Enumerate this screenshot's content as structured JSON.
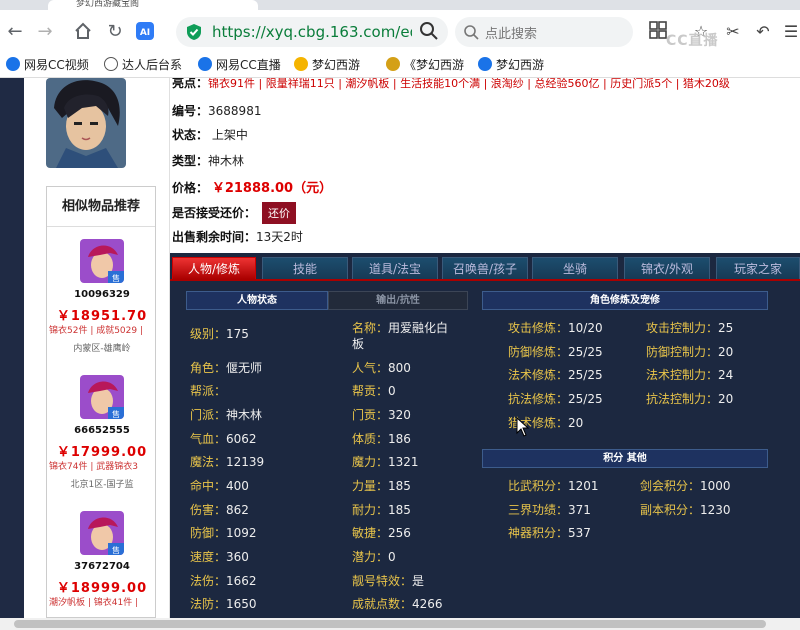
{
  "browser": {
    "tab_title": "梦幻西游藏宝阁",
    "url": "https://xyq.cbg.163.com/equip",
    "search_placeholder": "点此搜索",
    "watermark": "CC直播",
    "bookmarks": [
      {
        "label": "网易CC视频",
        "color": "#1a73e8"
      },
      {
        "label": "达人后台系",
        "color": "#555555"
      },
      {
        "label": "网易CC直播",
        "color": "#1a73e8"
      },
      {
        "label": "梦幻西游",
        "color": "#f5b400"
      },
      {
        "label": "《梦幻西游",
        "color": "#d4a017"
      },
      {
        "label": "梦幻西游",
        "color": "#1a73e8"
      }
    ]
  },
  "info": {
    "highlights_key": "亮点：",
    "highlights": "锦衣91件 | 限量祥瑞11只 | 潮汐帆板 | 生活技能10个满 | 浪淘纱 | 总经验560亿 | 历史门派5个 | 猎木20级",
    "id_key": "编号：",
    "id_value": "3688981",
    "status_key": "状态：",
    "status_value": "上架中",
    "type_key": "类型：",
    "type_value": "神木林",
    "price_key": "价格：",
    "price_value": "￥21888.00（元）",
    "bargain_key": "是否接受还价：",
    "bargain_button": "还价",
    "time_key": "出售剩余时间：",
    "time_value": "13天2时"
  },
  "similar": {
    "title": "相似物品推荐",
    "items": [
      {
        "id": "10096329",
        "price": "￥18951.70",
        "tags": "锦衣52件 | 成就5029 |",
        "server": "内蒙区-雄鹰岭"
      },
      {
        "id": "66652555",
        "price": "￥17999.00",
        "tags": "锦衣74件 | 武器锦衣3",
        "server": "北京1区-国子监"
      },
      {
        "id": "37672704",
        "price": "￥18999.00",
        "tags": "潮汐帆板 | 锦衣41件 |",
        "server": ""
      }
    ]
  },
  "detail": {
    "tabs": [
      "人物/修炼",
      "技能",
      "道具/法宝",
      "召唤兽/孩子",
      "坐骑",
      "锦衣/外观",
      "玩家之家"
    ],
    "left_tabs": [
      "人物状态",
      "输出/抗性"
    ],
    "right_header_1": "角色修炼及宠修",
    "right_header_2": "积分 其他",
    "col1": [
      {
        "k": "级别：",
        "v": "175"
      },
      {
        "k": "角色：",
        "v": "偃无师"
      },
      {
        "k": "帮派：",
        "v": ""
      },
      {
        "k": "门派：",
        "v": "神木林"
      },
      {
        "k": "气血：",
        "v": "6062"
      },
      {
        "k": "魔法：",
        "v": "12139"
      },
      {
        "k": "命中：",
        "v": "400"
      },
      {
        "k": "伤害：",
        "v": "862"
      },
      {
        "k": "防御：",
        "v": "1092"
      },
      {
        "k": "速度：",
        "v": "360"
      },
      {
        "k": "法伤：",
        "v": "1662"
      },
      {
        "k": "法防：",
        "v": "1650"
      }
    ],
    "name_key": "名称：",
    "name_line1": "用爱融化白",
    "name_line2": "板",
    "col2": [
      {
        "k": "人气：",
        "v": "800"
      },
      {
        "k": "帮贡：",
        "v": "0"
      },
      {
        "k": "门贡：",
        "v": "320"
      },
      {
        "k": "体质：",
        "v": "186"
      },
      {
        "k": "魔力：",
        "v": "1321"
      },
      {
        "k": "力量：",
        "v": "185"
      },
      {
        "k": "耐力：",
        "v": "185"
      },
      {
        "k": "敏捷：",
        "v": "256"
      },
      {
        "k": "潜力：",
        "v": "0"
      },
      {
        "k": "靓号特效：",
        "v": "是"
      },
      {
        "k": "成就点数：",
        "v": "4266"
      }
    ],
    "cultivation": [
      {
        "k": "攻击修炼：",
        "v": "10/20"
      },
      {
        "k": "防御修炼：",
        "v": "25/25"
      },
      {
        "k": "法术修炼：",
        "v": "25/25"
      },
      {
        "k": "抗法修炼：",
        "v": "25/25"
      },
      {
        "k": "猎术修炼：",
        "v": "20"
      }
    ],
    "control": [
      {
        "k": "攻击控制力：",
        "v": "25"
      },
      {
        "k": "防御控制力：",
        "v": "20"
      },
      {
        "k": "法术控制力：",
        "v": "24"
      },
      {
        "k": "抗法控制力：",
        "v": "20"
      }
    ],
    "points": [
      {
        "k": "比武积分：",
        "v": "1201"
      },
      {
        "k": "三界功绩：",
        "v": "371"
      },
      {
        "k": "神器积分：",
        "v": "537"
      }
    ],
    "points2": [
      {
        "k": "剑会积分：",
        "v": "1000"
      },
      {
        "k": "副本积分：",
        "v": "1230"
      }
    ]
  }
}
